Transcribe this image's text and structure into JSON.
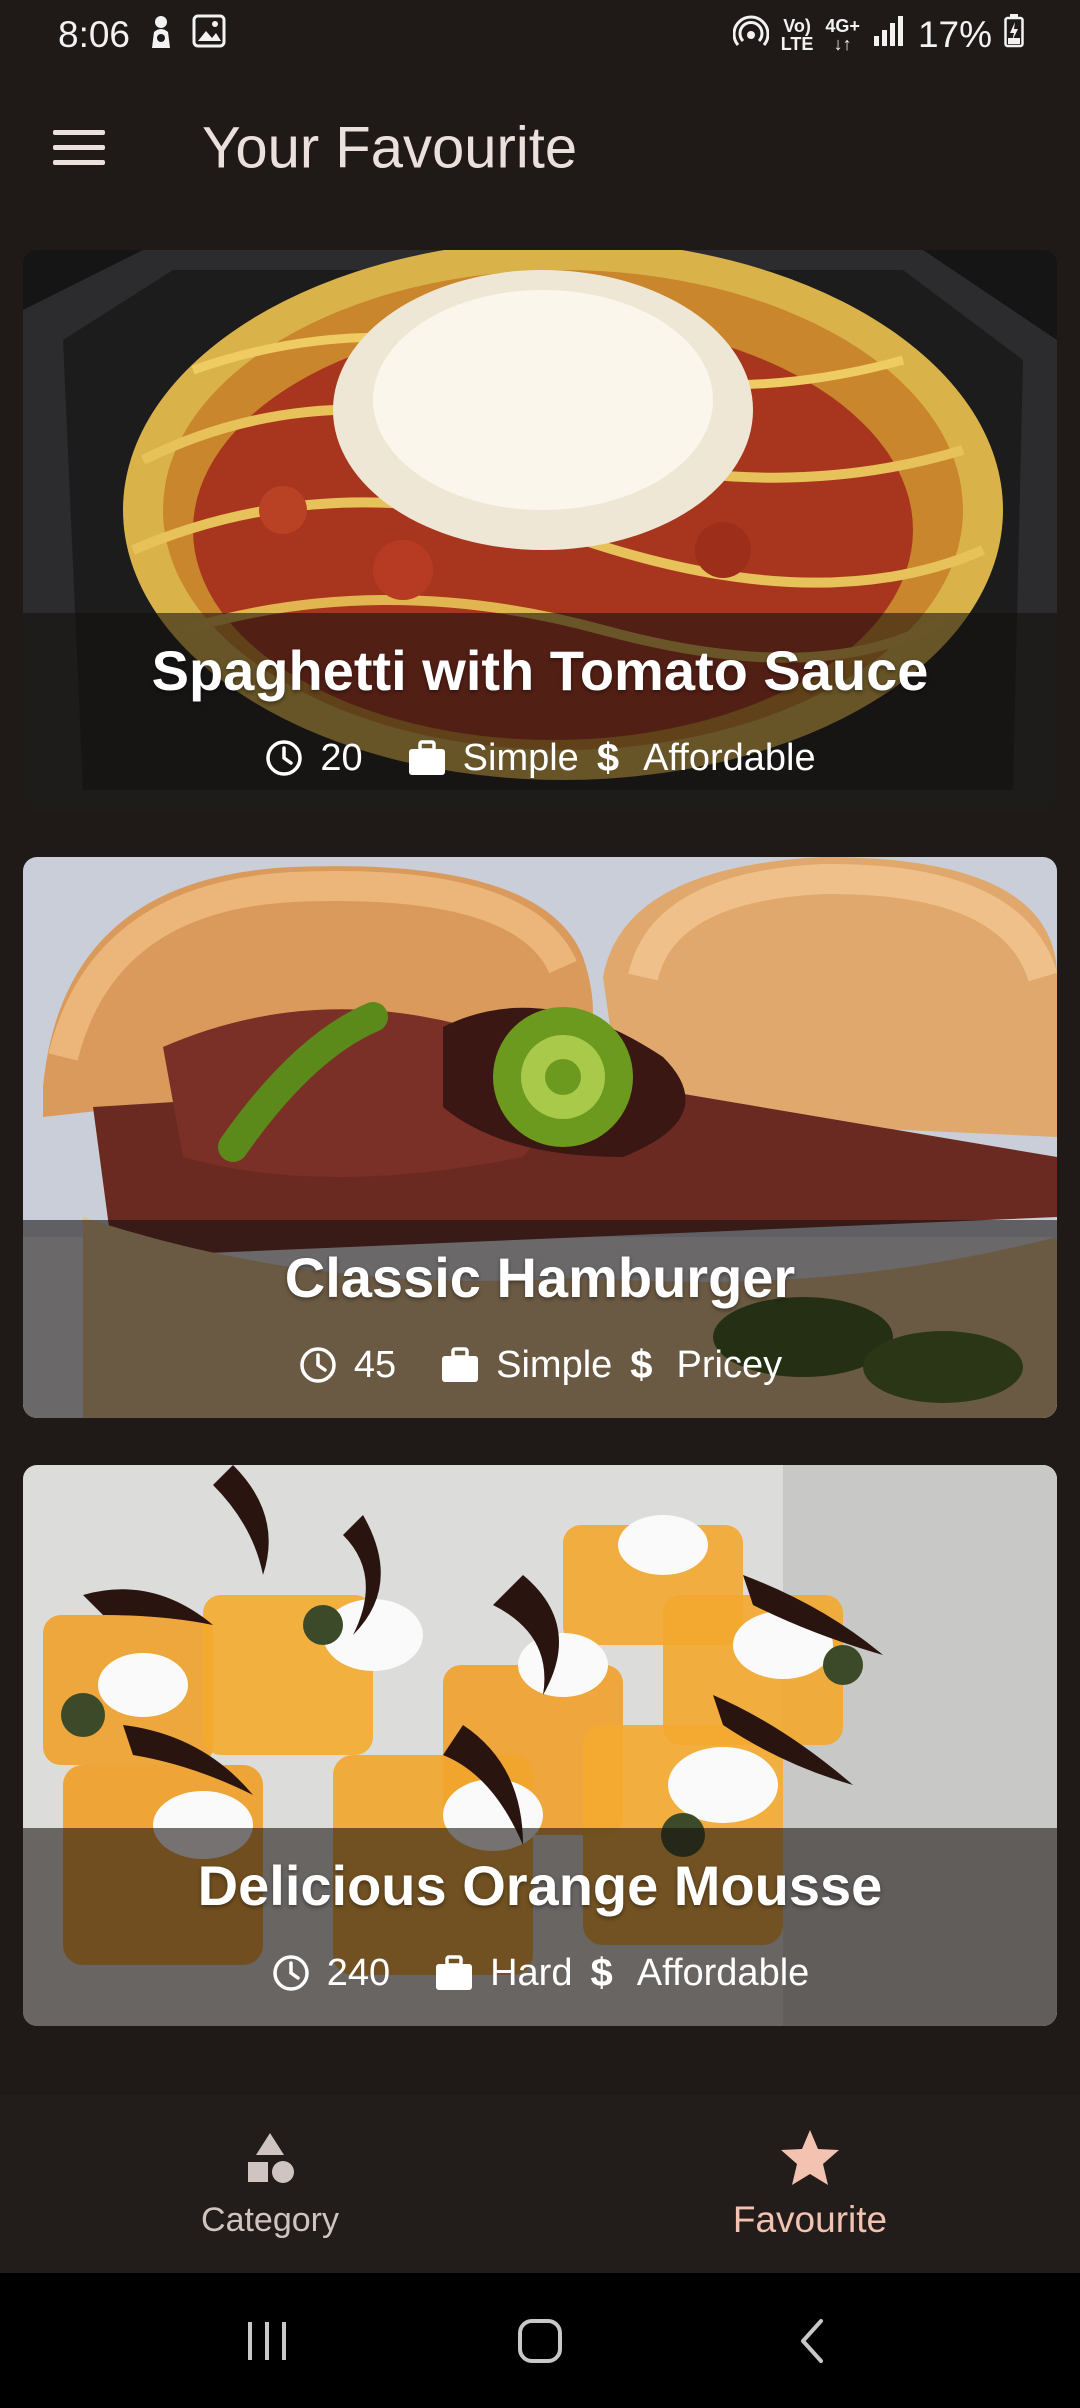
{
  "status_bar": {
    "time": "8:06",
    "volte_top": "Vo)",
    "volte_bottom": "LTE",
    "network": "4G+",
    "battery": "17%"
  },
  "app_bar": {
    "title": "Your Favourite"
  },
  "meals": [
    {
      "title": "Spaghetti with Tomato Sauce",
      "duration": "20",
      "complexity": "Simple",
      "affordability": "Affordable"
    },
    {
      "title": "Classic Hamburger",
      "duration": "45",
      "complexity": "Simple",
      "affordability": "Pricey"
    },
    {
      "title": "Delicious Orange Mousse",
      "duration": "240",
      "complexity": "Hard",
      "affordability": "Affordable"
    }
  ],
  "currency_symbol": "$",
  "bottom_nav": {
    "items": [
      {
        "label": "Category",
        "icon": "category-icon",
        "active": false
      },
      {
        "label": "Favourite",
        "icon": "star-icon",
        "active": true
      }
    ]
  },
  "colors": {
    "background": "#1f1a18",
    "active_accent": "#f3c2b0",
    "text_primary": "#ece0dc"
  }
}
